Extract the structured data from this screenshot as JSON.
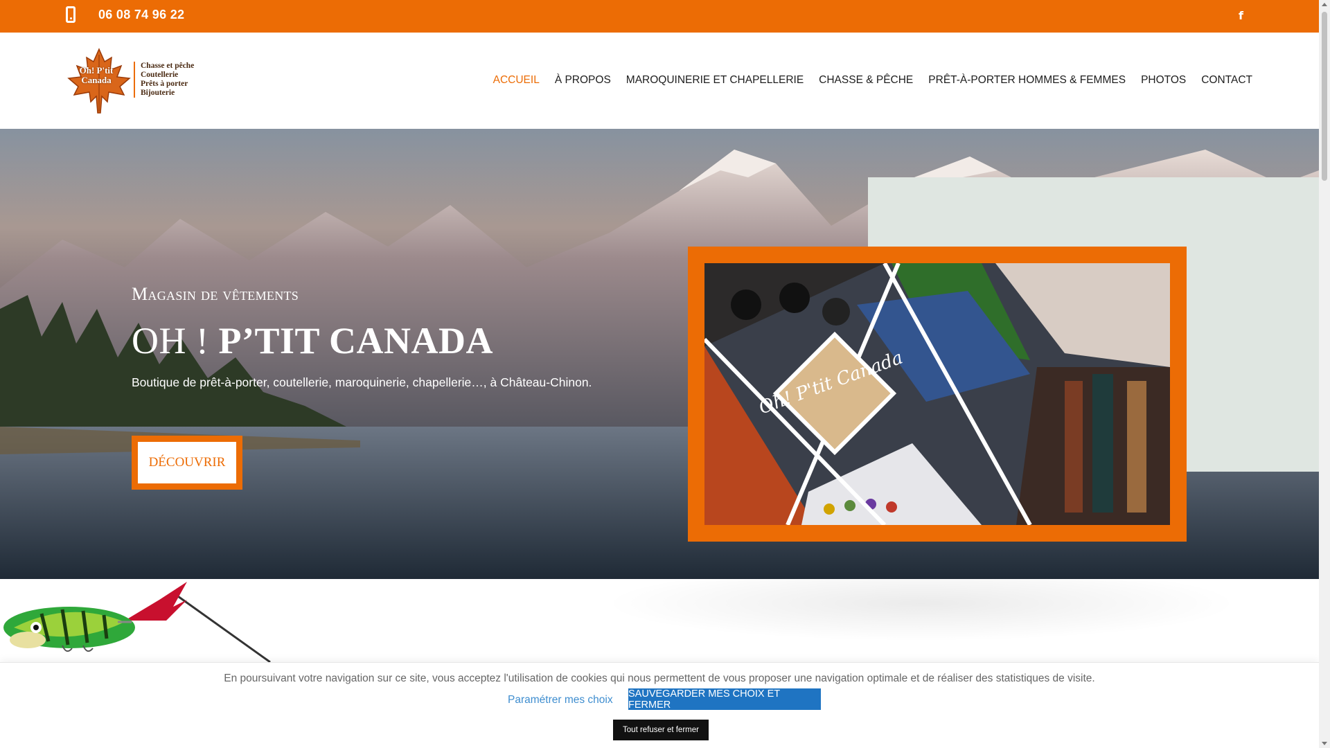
{
  "topbar": {
    "phone": "06 08 74 96 22",
    "facebook_glyph": "f",
    "bg_color": "#ec6c05"
  },
  "logo": {
    "leaf_text": "Oh! P'tit Canada",
    "lines": [
      "Chasse et pêche",
      "Coutellerie",
      "Prêts à porter",
      "Bijouterie"
    ]
  },
  "nav": {
    "items": [
      "ACCUEIL",
      "À PROPOS",
      "MAROQUINERIE ET CHAPELLERIE",
      "CHASSE & PÊCHE",
      "PRÊT-À-PORTER HOMMES & FEMMES",
      "PHOTOS",
      "CONTACT"
    ],
    "active": "ACCUEIL"
  },
  "hero": {
    "subtitle": "Magasin de vêtements",
    "title_light": "OH ! ",
    "title_bold": "P’TIT CANADA",
    "description": "Boutique de prêt-à-porter, coutellerie, maroquinerie, chapellerie…, à Château-Chinon.",
    "button": "DÉCOUVRIR",
    "collage_badge": "Oh! P'tit Canada"
  },
  "cookie": {
    "text": "En poursuivant votre navigation sur ce site, vous acceptez l'utilisation de cookies qui nous permettent de vous proposer une navigation optimale et de réaliser des statistiques de visite.",
    "settings_link": "Paramétrer mes choix",
    "save_button": "SAUVEGARDER MES CHOIX ET FERMER",
    "refuse_button": "Tout refuser et fermer"
  },
  "colors": {
    "accent": "#ec6c05",
    "cookie_button": "#1f74c2"
  }
}
